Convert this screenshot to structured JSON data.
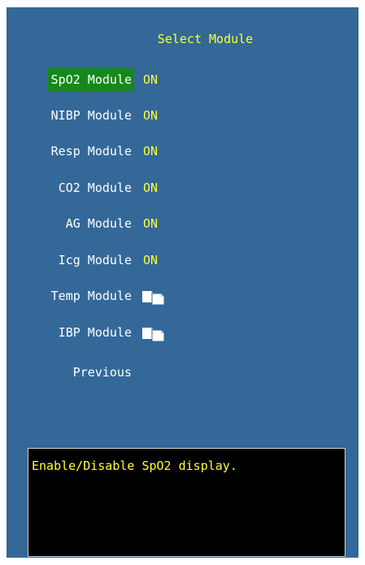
{
  "dialog": {
    "title": "Select Module",
    "items": [
      {
        "label": "SpO2 Module",
        "status": "ON",
        "selected": true
      },
      {
        "label": "NIBP Module",
        "status": "ON"
      },
      {
        "label": "Resp Module",
        "status": "ON"
      },
      {
        "label": "CO2 Module",
        "status": "ON"
      },
      {
        "label": "AG Module",
        "status": "ON"
      },
      {
        "label": "Icg Module",
        "status": "ON"
      },
      {
        "label": "Temp Module",
        "status_icon": "copy-pages-icon"
      },
      {
        "label": "IBP Module",
        "status_icon": "copy-pages-icon"
      }
    ],
    "previous_label": "Previous",
    "description": "Enable/Disable SpO2 display."
  },
  "colors": {
    "background": "#346899",
    "highlight": "#14891a",
    "value_text": "#ffff33",
    "label_text": "#ffffff",
    "help_background": "#000000"
  }
}
